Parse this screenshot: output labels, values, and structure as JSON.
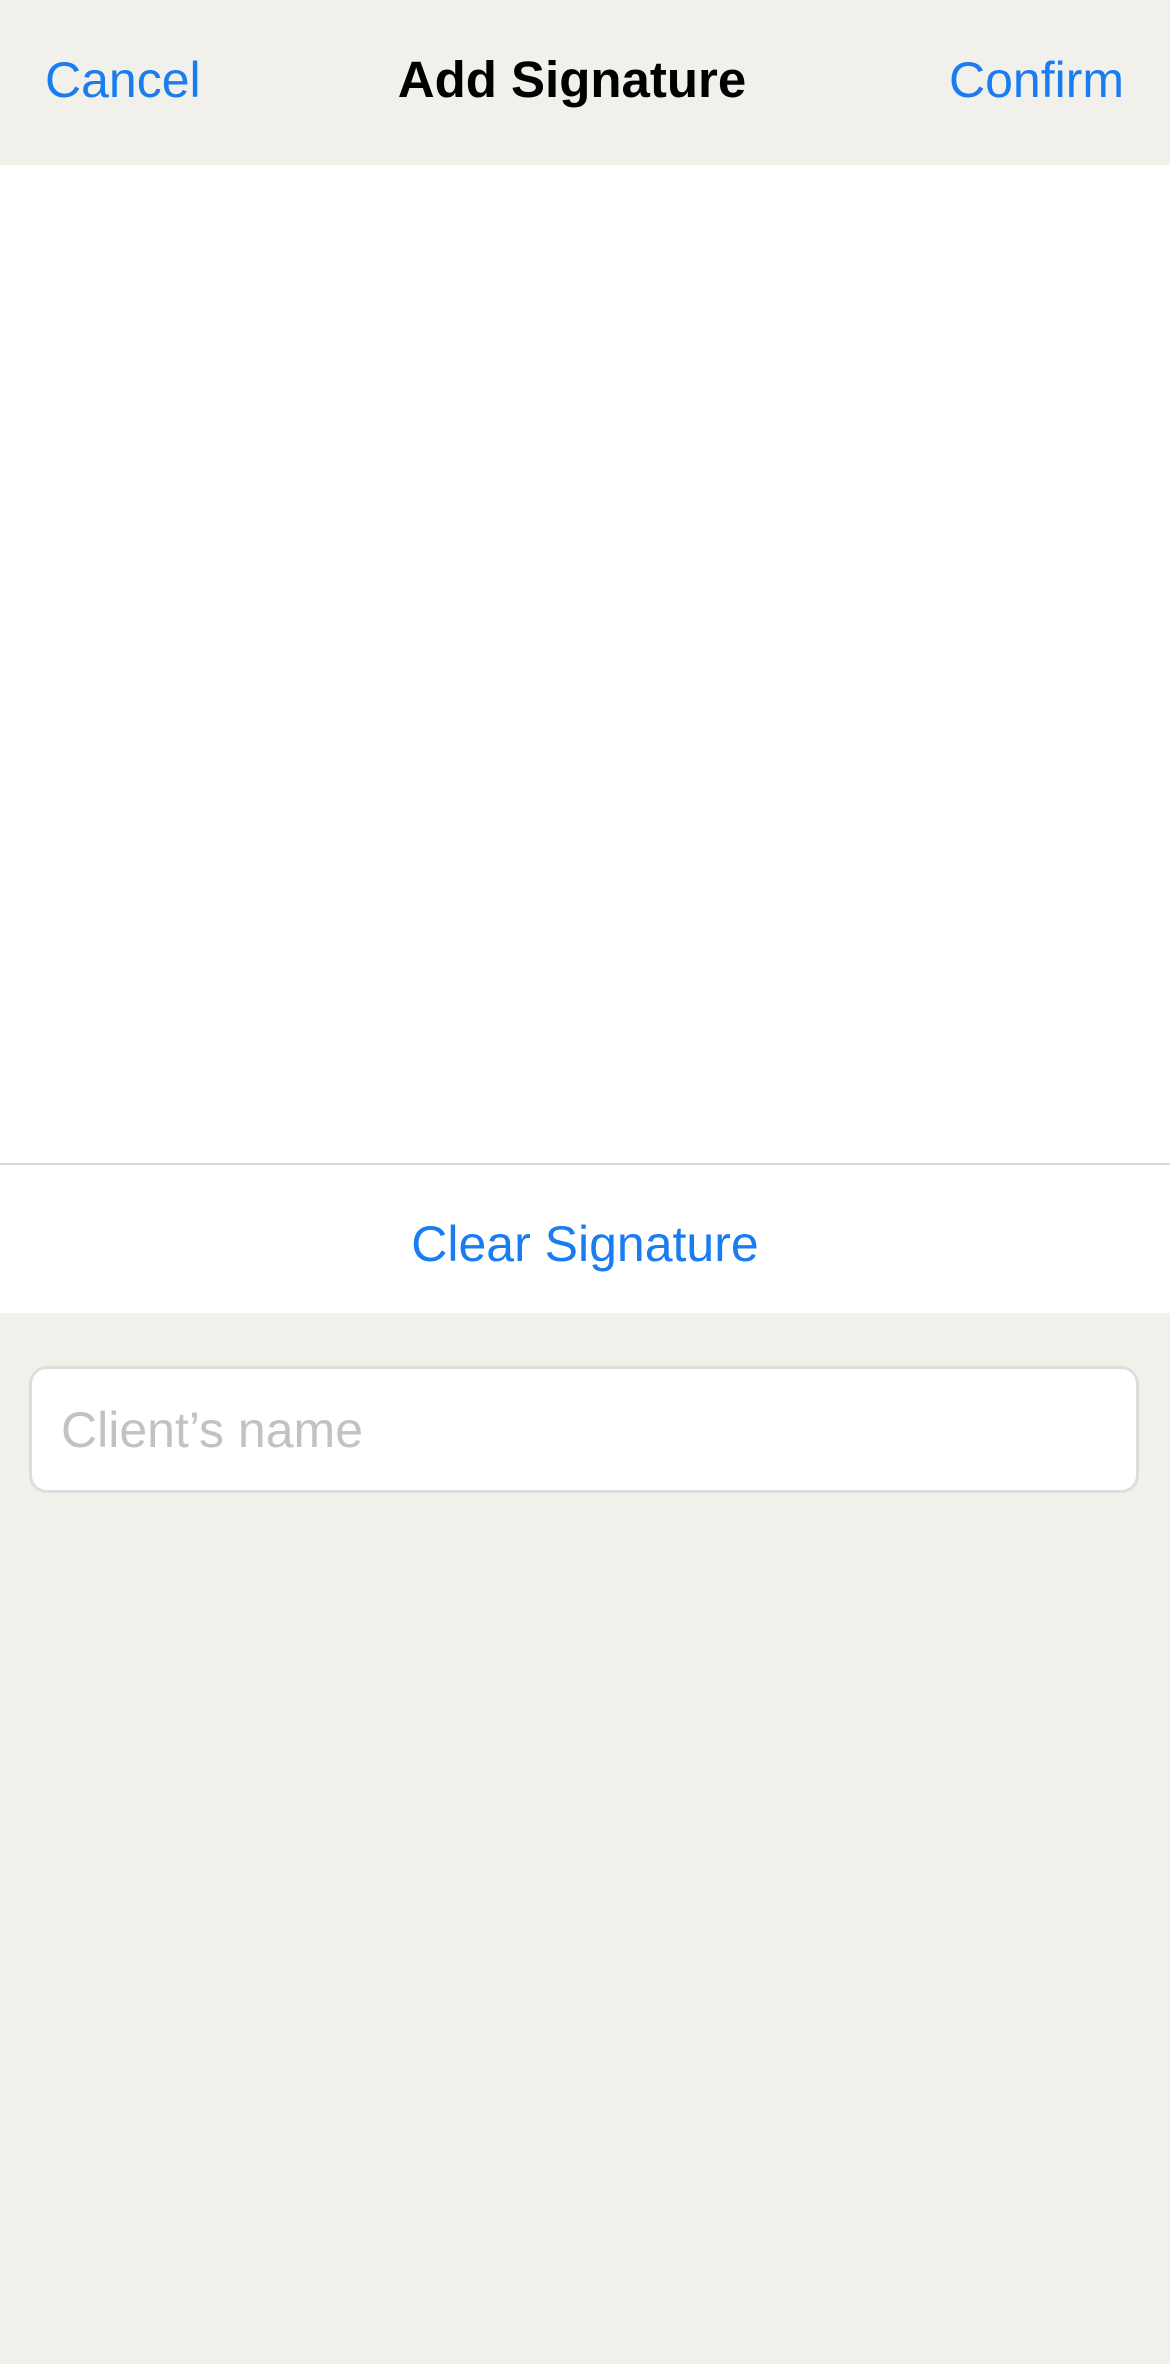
{
  "nav": {
    "cancel_label": "Cancel",
    "title": "Add Signature",
    "confirm_label": "Confirm"
  },
  "signature": {
    "clear_label": "Clear Signature"
  },
  "client_name": {
    "value": "",
    "placeholder": "Client’s name"
  },
  "colors": {
    "accent": "#1A7CF1",
    "background": "#F1F0EB",
    "surface": "#FFFFFF",
    "placeholder": "#C2C2C4"
  }
}
